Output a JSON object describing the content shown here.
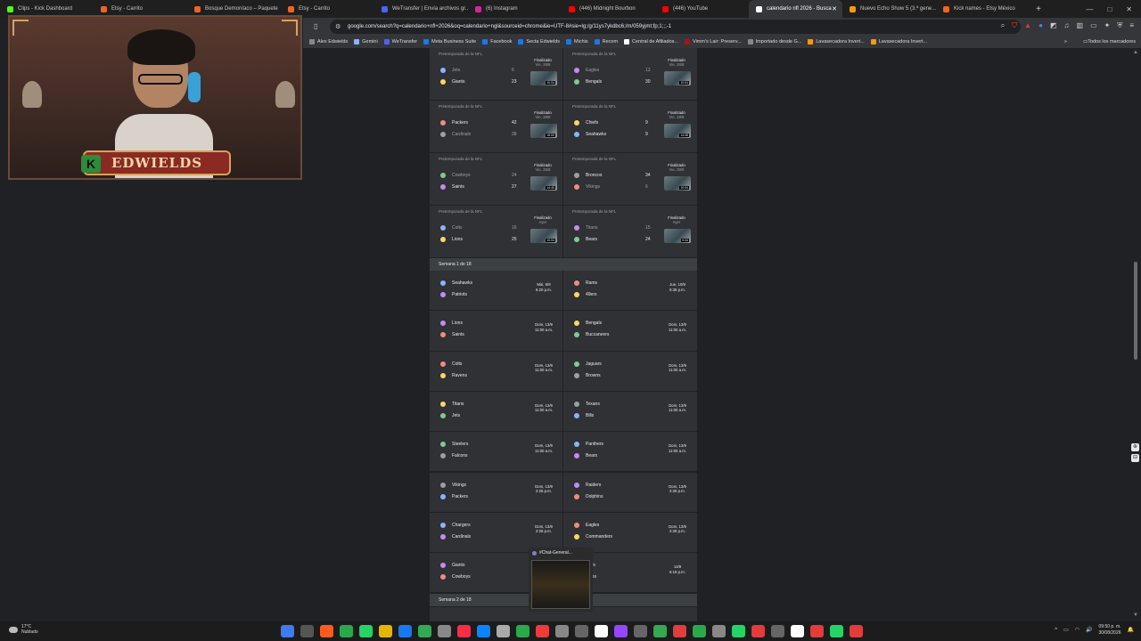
{
  "browser": {
    "tabs": [
      {
        "label": "Clips - Kick Dashboard",
        "color": "#53fc18"
      },
      {
        "label": "Etsy - Carrito",
        "color": "#f1641e"
      },
      {
        "label": "Bosque Demoníaco – Paquete",
        "color": "#f1641e"
      },
      {
        "label": "Etsy - Carrito",
        "color": "#f1641e"
      },
      {
        "label": "WeTransfer | Envía archivos gr...",
        "color": "#4a63ff"
      },
      {
        "label": "(6) Instagram",
        "color": "#d6249f"
      },
      {
        "label": "(446) Midnight Bourbon",
        "color": "#ff0000"
      },
      {
        "label": "(446) YouTube",
        "color": "#ff0000"
      },
      {
        "label": "calendario nfl 2026 - Busca",
        "color": "#ffffff",
        "active": true
      },
      {
        "label": "Nuevo Echo Show 5 (3.ª gene...",
        "color": "#ff9900"
      },
      {
        "label": "Kick names - Etsy México",
        "color": "#f1641e"
      }
    ],
    "address": "google.com/search?q=calendario+nfl+2026&oq=calendario+ngl&sourceid=chrome&ie=UTF-8#sie=lg;/g/11ys7ykdbc6;/m/059yjmt;fp;1;;;-1",
    "bookmarks": [
      {
        "label": "Alex Edwields",
        "color": "#888888"
      },
      {
        "label": "Gemini",
        "color": "#8ab4f8"
      },
      {
        "label": "WeTransfer",
        "color": "#4a63ff"
      },
      {
        "label": "Meta Business Suite",
        "color": "#1877f2"
      },
      {
        "label": "Facebook",
        "color": "#1877f2"
      },
      {
        "label": "Secta Edwields",
        "color": "#1877f2"
      },
      {
        "label": "Michis",
        "color": "#1877f2"
      },
      {
        "label": "Recom",
        "color": "#1877f2"
      },
      {
        "label": "Central de Afiliados...",
        "color": "#ffffff"
      },
      {
        "label": "Vimm's Lair: Preserv...",
        "color": "#b01010"
      },
      {
        "label": "Importado desde G...",
        "color": "#888888"
      },
      {
        "label": "Lavasecadora Invert...",
        "color": "#ff9900"
      },
      {
        "label": "Lavasecadora Invert...",
        "color": "#ff9900"
      }
    ],
    "all_bookmarks": "Todos los marcadores"
  },
  "preseason": {
    "tag": "Pretemporada de la NFL",
    "games": [
      {
        "left": {
          "t1": "Jets",
          "s1": "6",
          "t2": "Giants",
          "s2": "23",
          "status": "Finalizado",
          "date": "Vie, 28/8",
          "dur": "10:04",
          "w": 2
        },
        "right": {
          "t1": "Eagles",
          "s1": "13",
          "t2": "Bengals",
          "s2": "30",
          "status": "Finalizado",
          "date": "Vie, 28/8",
          "dur": "10:04",
          "w": 2
        }
      },
      {
        "left": {
          "t1": "Packers",
          "s1": "42",
          "t2": "Cardinals",
          "s2": "38",
          "status": "Finalizado",
          "date": "Vie, 28/8",
          "dur": "15:00",
          "w": 1
        },
        "right": {
          "t1": "Chiefs",
          "s1": "9",
          "t2": "Seahawks",
          "s2": "9",
          "status": "Finalizado",
          "date": "Vie, 28/8",
          "dur": "14:08",
          "w": 0
        }
      },
      {
        "left": {
          "t1": "Cowboys",
          "s1": "24",
          "t2": "Saints",
          "s2": "27",
          "status": "Finalizado",
          "date": "Vie, 28/8",
          "dur": "14:40",
          "w": 2
        },
        "right": {
          "t1": "Broncos",
          "s1": "34",
          "t2": "Vikings",
          "s2": "6",
          "status": "Finalizado",
          "date": "Vie, 28/8",
          "dur": "10:04",
          "w": 1
        }
      },
      {
        "left": {
          "t1": "Colts",
          "s1": "16",
          "t2": "Lions",
          "s2": "25",
          "status": "Finalizado",
          "date": "Ayer",
          "dur": "10:04",
          "w": 2
        },
        "right": {
          "t1": "Titans",
          "s1": "15",
          "t2": "Bears",
          "s2": "24",
          "status": "Finalizado",
          "date": "Ayer",
          "dur": "9:34",
          "w": 2
        }
      }
    ]
  },
  "week1": {
    "header": "Semana 1 de 18",
    "games": [
      {
        "left": {
          "t1": "Seahawks",
          "t2": "Patriots",
          "d": "Mié, 9/9",
          "h": "6:20 p.m."
        },
        "right": {
          "t1": "Rams",
          "t2": "49ers",
          "d": "Jue, 10/9",
          "h": "6:35 p.m."
        }
      },
      {
        "left": {
          "t1": "Lions",
          "t2": "Saints",
          "d": "Dom, 13/9",
          "h": "11:00 a.m."
        },
        "right": {
          "t1": "Bengals",
          "t2": "Buccaneers",
          "d": "Dom, 13/9",
          "h": "11:00 a.m."
        }
      },
      {
        "left": {
          "t1": "Colts",
          "t2": "Ravens",
          "d": "Dom, 13/9",
          "h": "11:00 a.m."
        },
        "right": {
          "t1": "Jaguars",
          "t2": "Browns",
          "d": "Dom, 13/9",
          "h": "11:00 a.m."
        }
      },
      {
        "left": {
          "t1": "Titans",
          "t2": "Jets",
          "d": "Dom, 13/9",
          "h": "11:00 a.m."
        },
        "right": {
          "t1": "Texans",
          "t2": "Bills",
          "d": "Dom, 13/9",
          "h": "11:00 a.m."
        }
      },
      {
        "left": {
          "t1": "Steelers",
          "t2": "Falcons",
          "d": "Dom, 13/9",
          "h": "11:00 a.m."
        },
        "right": {
          "t1": "Panthers",
          "t2": "Bears",
          "d": "Dom, 13/9",
          "h": "11:00 a.m."
        }
      },
      {
        "left": {
          "t1": "Vikings",
          "t2": "Packers",
          "d": "Dom, 13/9",
          "h": "2:25 p.m."
        },
        "right": {
          "t1": "Raiders",
          "t2": "Dolphins",
          "d": "Dom, 13/9",
          "h": "2:25 p.m."
        }
      },
      {
        "left": {
          "t1": "Chargers",
          "t2": "Cardinals",
          "d": "Dom, 13/9",
          "h": "2:25 p.m."
        },
        "right": {
          "t1": "Eagles",
          "t2": "Commanders",
          "d": "Dom, 13/9",
          "h": "2:25 p.m."
        }
      },
      {
        "left": {
          "t1": "Giants",
          "t2": "Cowboys",
          "d": "Dom, 13/9",
          "h": "6:20 p.m."
        },
        "right": {
          "t1": "...efs",
          "t2": "...cos",
          "d": "14/9",
          "h": "6:15 p.m."
        }
      }
    ]
  },
  "week2": {
    "header": "Semana 2 de 18"
  },
  "webcam": {
    "banner": "EDWIELDS",
    "k": "K"
  },
  "chat_popup": {
    "title": "#Chat-General..."
  },
  "taskbar": {
    "weather_temp": "17°C",
    "weather_desc": "Nublado",
    "time": "09:50 p. m.",
    "date": "30/08/2026",
    "apps": [
      "#3c7cf0",
      "#555555",
      "#ff5a1f",
      "#2aa84a",
      "#25d366",
      "#e8b400",
      "#1877f2",
      "#34a853",
      "#888888",
      "#fa2d48",
      "#0a84ff",
      "#aaaaaa",
      "#2aa84a",
      "#eb3b3b",
      "#888888",
      "#666666",
      "#ffffff",
      "#9146ff",
      "#666666",
      "#34a853",
      "#e23c3c",
      "#2aa84a",
      "#888888",
      "#25d366",
      "#e23c3c",
      "#666666",
      "#ffffff",
      "#e23c3c",
      "#25d366",
      "#e23c3c"
    ]
  }
}
